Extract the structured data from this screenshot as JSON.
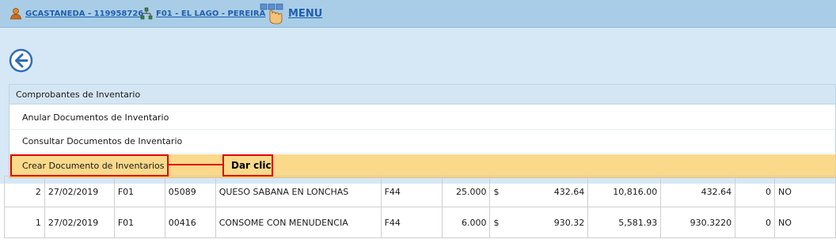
{
  "topbar": {
    "user_link": "GCASTANEDA - 119958726",
    "branch_link": "F01 - EL LAGO - PEREIRA",
    "menu_label": "MENU"
  },
  "icons": {
    "user": "user-icon",
    "branch": "network-icon",
    "menu": "hand-pointer-icon",
    "back": "arrow-left-circle-icon"
  },
  "menu": {
    "header": "Comprobantes de Inventario",
    "items": [
      "Anular Documentos de Inventario",
      "Consultar Documentos de Inventario",
      "Crear Documento de Inventarios"
    ]
  },
  "annotation": {
    "label": "Dar clic"
  },
  "table": {
    "rows": [
      [
        "2",
        "27/02/2019",
        "F01",
        "05089",
        "QUESO SABANA EN LONCHAS",
        "F44",
        "25.000",
        "$",
        "432.64",
        "10,816.00",
        "432.64",
        "0",
        "NO"
      ],
      [
        "1",
        "27/02/2019",
        "F01",
        "00416",
        "CONSOME CON MENUDENCIA",
        "F44",
        "6.000",
        "$",
        "930.32",
        "5,581.93",
        "930.3220",
        "0",
        "NO"
      ]
    ]
  },
  "colors": {
    "topbar": "#a9cde6",
    "panel": "#d6e8f5",
    "highlight": "#fad98a",
    "annotation": "#e00000",
    "link": "#1f5fb0"
  }
}
